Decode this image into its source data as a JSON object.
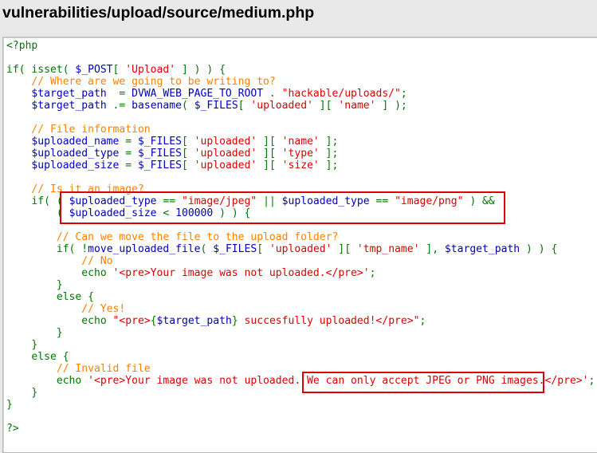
{
  "page_title": "vulnerabilities/upload/source/medium.php",
  "code_lines": [
    [
      [
        "kw",
        "<?php"
      ]
    ],
    [],
    [
      [
        "kw",
        "if( isset( "
      ],
      [
        "var",
        "$_POST"
      ],
      [
        "kw",
        "[ "
      ],
      [
        "str",
        "'Upload'"
      ],
      [
        "kw",
        " ] ) ) {"
      ]
    ],
    [
      [
        "cmt",
        "    // Where are we going to be writing to?"
      ]
    ],
    [
      [
        "var",
        "    $target_path  "
      ],
      [
        "kw",
        "= "
      ],
      [
        "var",
        "DVWA_WEB_PAGE_TO_ROOT "
      ],
      [
        "kw",
        ". "
      ],
      [
        "str",
        "\"hackable/uploads/\""
      ],
      [
        "kw",
        ";"
      ]
    ],
    [
      [
        "var",
        "    $target_path "
      ],
      [
        "kw",
        ".= "
      ],
      [
        "var",
        "basename"
      ],
      [
        "kw",
        "( "
      ],
      [
        "var",
        "$_FILES"
      ],
      [
        "kw",
        "[ "
      ],
      [
        "str",
        "'uploaded'"
      ],
      [
        "kw",
        " ][ "
      ],
      [
        "str",
        "'name'"
      ],
      [
        "kw",
        " ] );"
      ]
    ],
    [],
    [
      [
        "cmt",
        "    // File information"
      ]
    ],
    [
      [
        "var",
        "    $uploaded_name "
      ],
      [
        "kw",
        "= "
      ],
      [
        "var",
        "$_FILES"
      ],
      [
        "kw",
        "[ "
      ],
      [
        "str",
        "'uploaded'"
      ],
      [
        "kw",
        " ][ "
      ],
      [
        "str",
        "'name'"
      ],
      [
        "kw",
        " ];"
      ]
    ],
    [
      [
        "var",
        "    $uploaded_type "
      ],
      [
        "kw",
        "= "
      ],
      [
        "var",
        "$_FILES"
      ],
      [
        "kw",
        "[ "
      ],
      [
        "str",
        "'uploaded'"
      ],
      [
        "kw",
        " ][ "
      ],
      [
        "str",
        "'type'"
      ],
      [
        "kw",
        " ];"
      ]
    ],
    [
      [
        "var",
        "    $uploaded_size "
      ],
      [
        "kw",
        "= "
      ],
      [
        "var",
        "$_FILES"
      ],
      [
        "kw",
        "[ "
      ],
      [
        "str",
        "'uploaded'"
      ],
      [
        "kw",
        " ][ "
      ],
      [
        "str",
        "'size'"
      ],
      [
        "kw",
        " ];"
      ]
    ],
    [],
    [
      [
        "cmt",
        "    // Is it an image?"
      ]
    ],
    [
      [
        "kw",
        "    if( ( "
      ],
      [
        "var",
        "$uploaded_type "
      ],
      [
        "kw",
        "== "
      ],
      [
        "str",
        "\"image/jpeg\""
      ],
      [
        "kw",
        " || "
      ],
      [
        "var",
        "$uploaded_type "
      ],
      [
        "kw",
        "== "
      ],
      [
        "str",
        "\"image/png\""
      ],
      [
        "kw",
        " ) &&"
      ]
    ],
    [
      [
        "kw",
        "        ( "
      ],
      [
        "var",
        "$uploaded_size "
      ],
      [
        "kw",
        "< "
      ],
      [
        "var",
        "100000"
      ],
      [
        "kw",
        " ) ) {"
      ]
    ],
    [],
    [
      [
        "cmt",
        "        // Can we move the file to the upload folder?"
      ]
    ],
    [
      [
        "kw",
        "        if( !"
      ],
      [
        "var",
        "move_uploaded_file"
      ],
      [
        "kw",
        "( "
      ],
      [
        "var",
        "$_FILES"
      ],
      [
        "kw",
        "[ "
      ],
      [
        "str",
        "'uploaded'"
      ],
      [
        "kw",
        " ][ "
      ],
      [
        "str",
        "'tmp_name'"
      ],
      [
        "kw",
        " ], "
      ],
      [
        "var",
        "$target_path"
      ],
      [
        "kw",
        " ) ) {"
      ]
    ],
    [
      [
        "cmt",
        "            // No"
      ]
    ],
    [
      [
        "kw",
        "            echo "
      ],
      [
        "str",
        "'<pre>Your image was not uploaded.</pre>'"
      ],
      [
        "kw",
        ";"
      ]
    ],
    [
      [
        "kw",
        "        }"
      ]
    ],
    [
      [
        "kw",
        "        else {"
      ]
    ],
    [
      [
        "cmt",
        "            // Yes!"
      ]
    ],
    [
      [
        "kw",
        "            echo "
      ],
      [
        "str",
        "\"<pre>"
      ],
      [
        "kw",
        "{"
      ],
      [
        "var",
        "$target_path"
      ],
      [
        "kw",
        "}"
      ],
      [
        "str",
        " succesfully uploaded!</pre>\""
      ],
      [
        "kw",
        ";"
      ]
    ],
    [
      [
        "kw",
        "        }"
      ]
    ],
    [
      [
        "kw",
        "    }"
      ]
    ],
    [
      [
        "kw",
        "    else {"
      ]
    ],
    [
      [
        "cmt",
        "        // Invalid file"
      ]
    ],
    [
      [
        "kw",
        "        echo "
      ],
      [
        "str",
        "'<pre>Your image was not uploaded. We can only accept JPEG or PNG images.</pre>'"
      ],
      [
        "kw",
        ";"
      ]
    ],
    [
      [
        "kw",
        "    }"
      ]
    ],
    [
      [
        "kw",
        "}"
      ]
    ],
    [],
    [
      [
        "kw",
        "?>"
      ]
    ]
  ],
  "colors": {
    "keyword": "#007700",
    "variable": "#0000bb",
    "string": "#dd0000",
    "comment": "#ff8000",
    "highlight": "#e00000"
  }
}
